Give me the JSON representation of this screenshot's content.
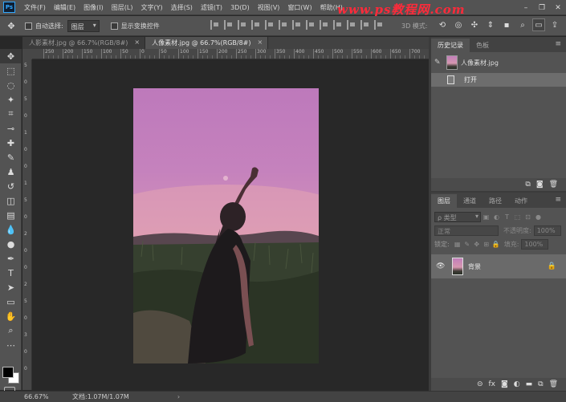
{
  "app": {
    "logo": "Ps",
    "watermark": "www.ps教程网.com"
  },
  "menu": [
    "文件(F)",
    "编辑(E)",
    "图像(I)",
    "图层(L)",
    "文字(Y)",
    "选择(S)",
    "滤镜(T)",
    "3D(D)",
    "视图(V)",
    "窗口(W)",
    "帮助(H)"
  ],
  "window_controls": [
    "–",
    "❐",
    "✕"
  ],
  "options": {
    "auto_select_label": "自动选择:",
    "auto_select_target": "图层",
    "show_transform_label": "显示变换控件",
    "mode_3d_label": "3D 模式:"
  },
  "tabs": [
    {
      "label": "人影素材.jpg @ 66.7%(RGB/8#)",
      "close": "×"
    },
    {
      "label": "人像素材.jpg @ 66.7%(RGB/8#)",
      "close": "×"
    }
  ],
  "ruler_h": [
    "250",
    "200",
    "150",
    "100",
    "50",
    "0",
    "50",
    "100",
    "150",
    "200",
    "250",
    "300",
    "350",
    "400",
    "450",
    "500",
    "550",
    "600",
    "650",
    "700",
    "750"
  ],
  "ruler_v": [
    "5",
    "0",
    "5",
    "0",
    "1",
    "0",
    "0",
    "1",
    "5",
    "0",
    "2",
    "0",
    "0",
    "2",
    "5",
    "0",
    "3",
    "0",
    "0"
  ],
  "status": {
    "zoom": "66.67%",
    "doc": "文档:1.07M/1.07M",
    "arrow": "›"
  },
  "history_panel": {
    "tabs": [
      "历史记录",
      "色板"
    ],
    "snapshot_label": "人像素材.jpg",
    "state_label": "打开"
  },
  "layers_panel": {
    "tabs": [
      "图层",
      "通道",
      "路径",
      "动作"
    ],
    "kind_placeholder": "ρ 类型",
    "blend_mode": "正常",
    "opacity_label": "不透明度:",
    "opacity_value": "100%",
    "lock_label": "锁定:",
    "fill_label": "填充:",
    "fill_value": "100%",
    "layer_name": "背景"
  },
  "colors": {
    "foreground": "#000000",
    "background": "#ffffff"
  }
}
